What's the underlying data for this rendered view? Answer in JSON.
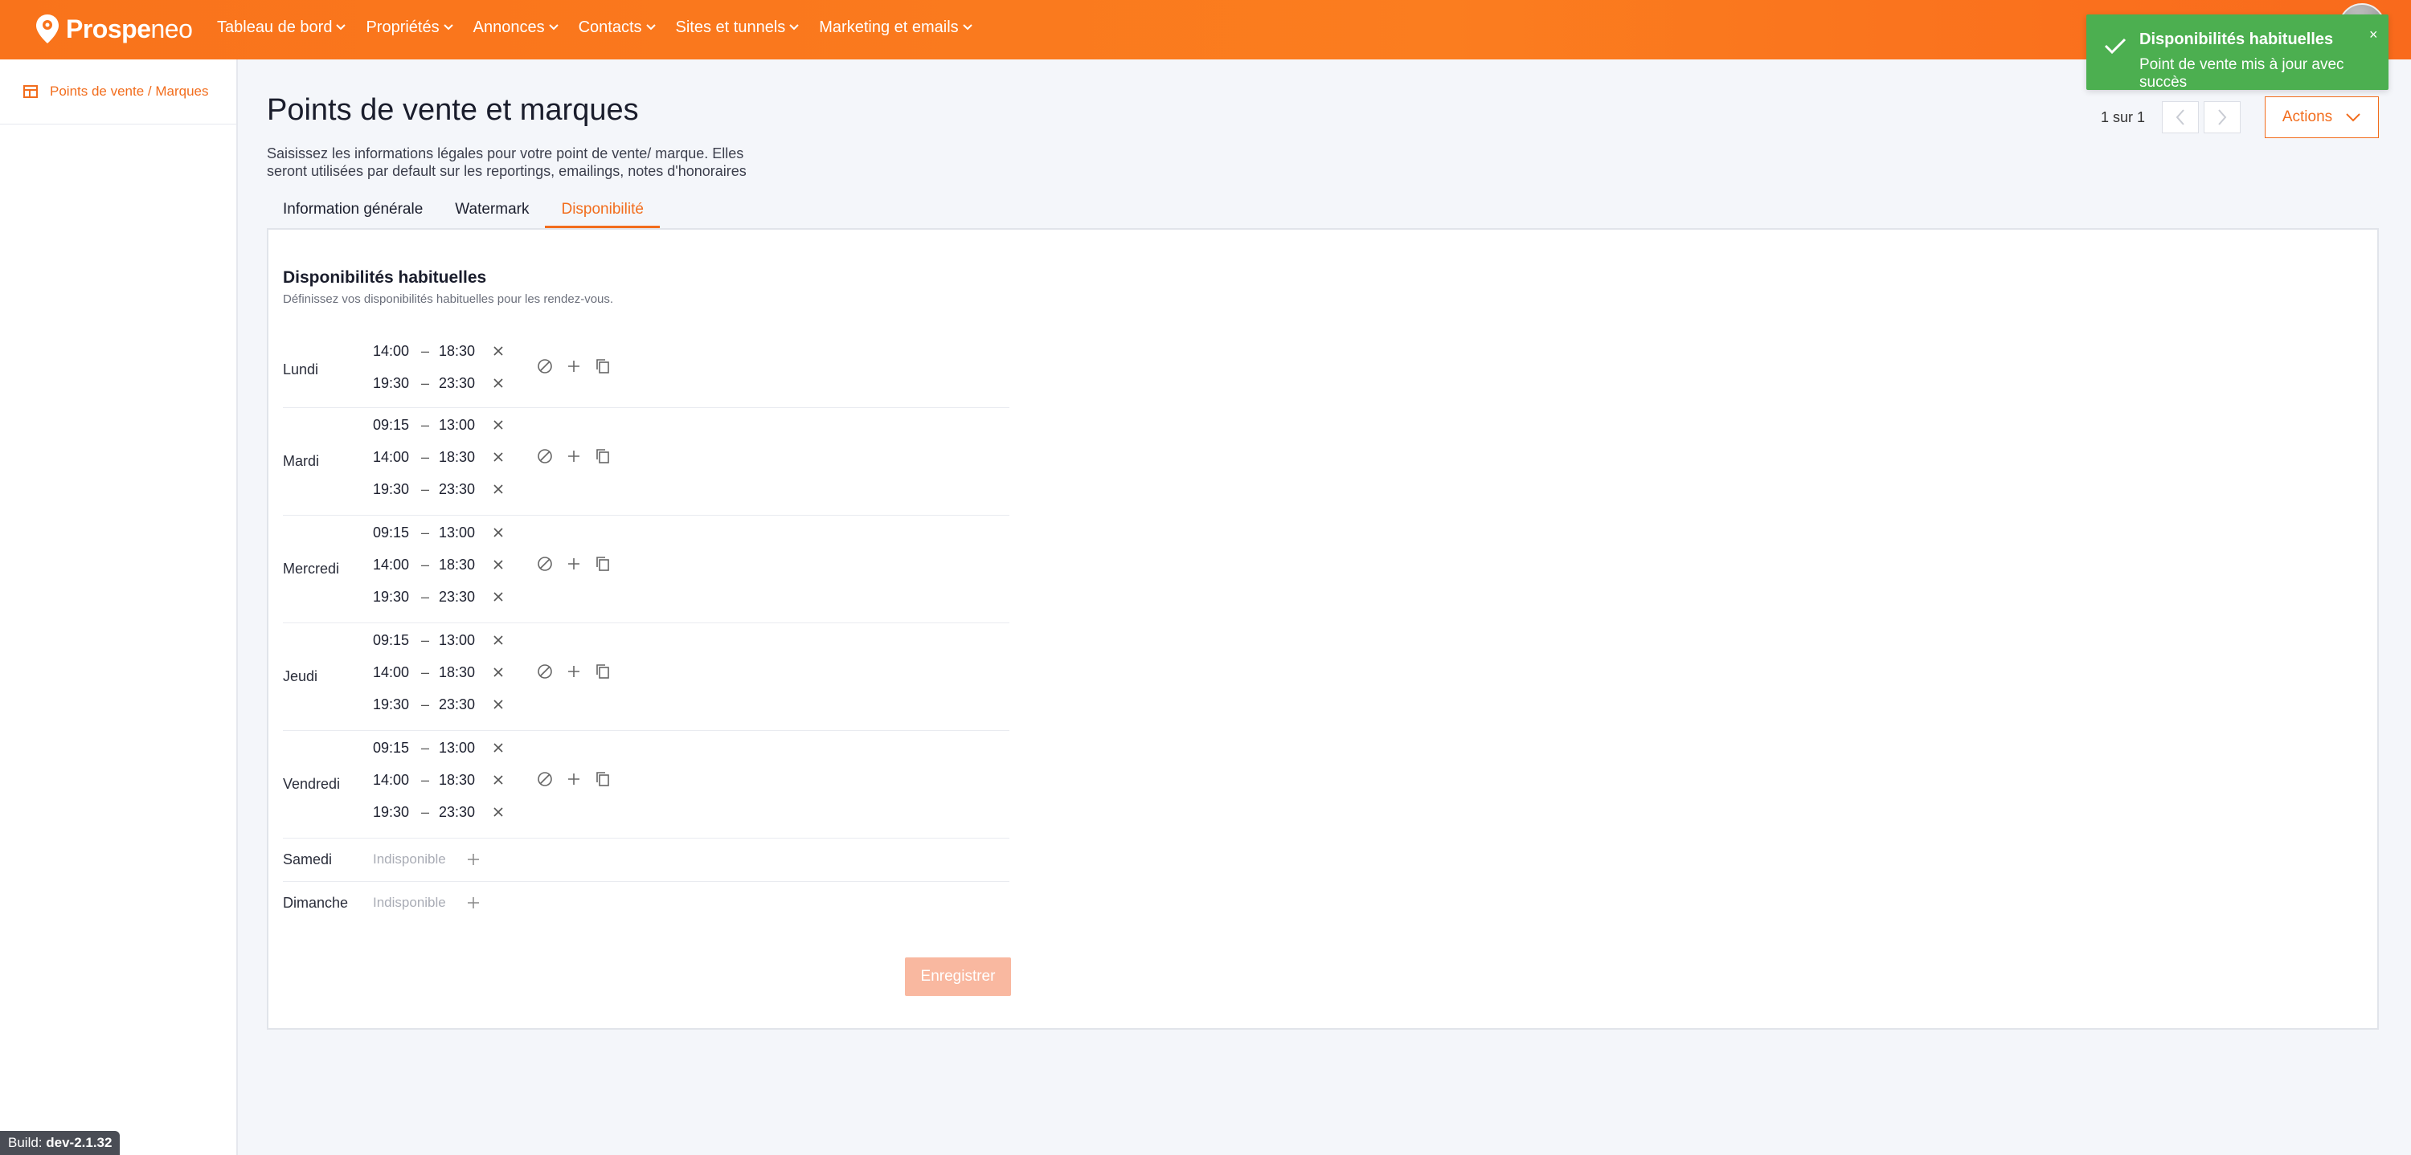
{
  "brand": {
    "name_bold": "Prospe",
    "name_light": "neo",
    "accent": "#f26d1d"
  },
  "nav": [
    {
      "label": "Tableau de bord"
    },
    {
      "label": "Propriétés"
    },
    {
      "label": "Annonces"
    },
    {
      "label": "Contacts"
    },
    {
      "label": "Sites et tunnels"
    },
    {
      "label": "Marketing et emails"
    }
  ],
  "toast": {
    "title": "Disponibilités habituelles",
    "message": "Point de vente mis à jour avec succès",
    "close": "×",
    "color": "#4caf50"
  },
  "sidebar": {
    "item_label": "Points de vente / Marques"
  },
  "build": {
    "prefix": "Build: ",
    "version": "dev-2.1.32"
  },
  "header": {
    "title": "Points de vente et marques",
    "description": "Saisissez les informations légales pour votre point de vente/ marque. Elles seront utilisées par default sur les reportings, emailings, notes d'honoraires",
    "pager": "1 sur 1",
    "actions_label": "Actions"
  },
  "tabs": [
    {
      "label": "Information générale",
      "active": false
    },
    {
      "label": "Watermark",
      "active": false
    },
    {
      "label": "Disponibilité",
      "active": true
    }
  ],
  "availability": {
    "title": "Disponibilités habituelles",
    "subtitle": "Définissez vos disponibilités habituelles pour les rendez-vous.",
    "separator": "–",
    "days": [
      {
        "name": "Lundi",
        "slots": [
          {
            "start": "14:00",
            "end": "18:30"
          },
          {
            "start": "19:30",
            "end": "23:30"
          }
        ]
      },
      {
        "name": "Mardi",
        "slots": [
          {
            "start": "09:15",
            "end": "13:00"
          },
          {
            "start": "14:00",
            "end": "18:30"
          },
          {
            "start": "19:30",
            "end": "23:30"
          }
        ]
      },
      {
        "name": "Mercredi",
        "slots": [
          {
            "start": "09:15",
            "end": "13:00"
          },
          {
            "start": "14:00",
            "end": "18:30"
          },
          {
            "start": "19:30",
            "end": "23:30"
          }
        ]
      },
      {
        "name": "Jeudi",
        "slots": [
          {
            "start": "09:15",
            "end": "13:00"
          },
          {
            "start": "14:00",
            "end": "18:30"
          },
          {
            "start": "19:30",
            "end": "23:30"
          }
        ]
      },
      {
        "name": "Vendredi",
        "slots": [
          {
            "start": "09:15",
            "end": "13:00"
          },
          {
            "start": "14:00",
            "end": "18:30"
          },
          {
            "start": "19:30",
            "end": "23:30"
          }
        ]
      },
      {
        "name": "Samedi",
        "unavailable": "Indisponible"
      },
      {
        "name": "Dimanche",
        "unavailable": "Indisponible"
      }
    ],
    "save_label": "Enregistrer"
  }
}
